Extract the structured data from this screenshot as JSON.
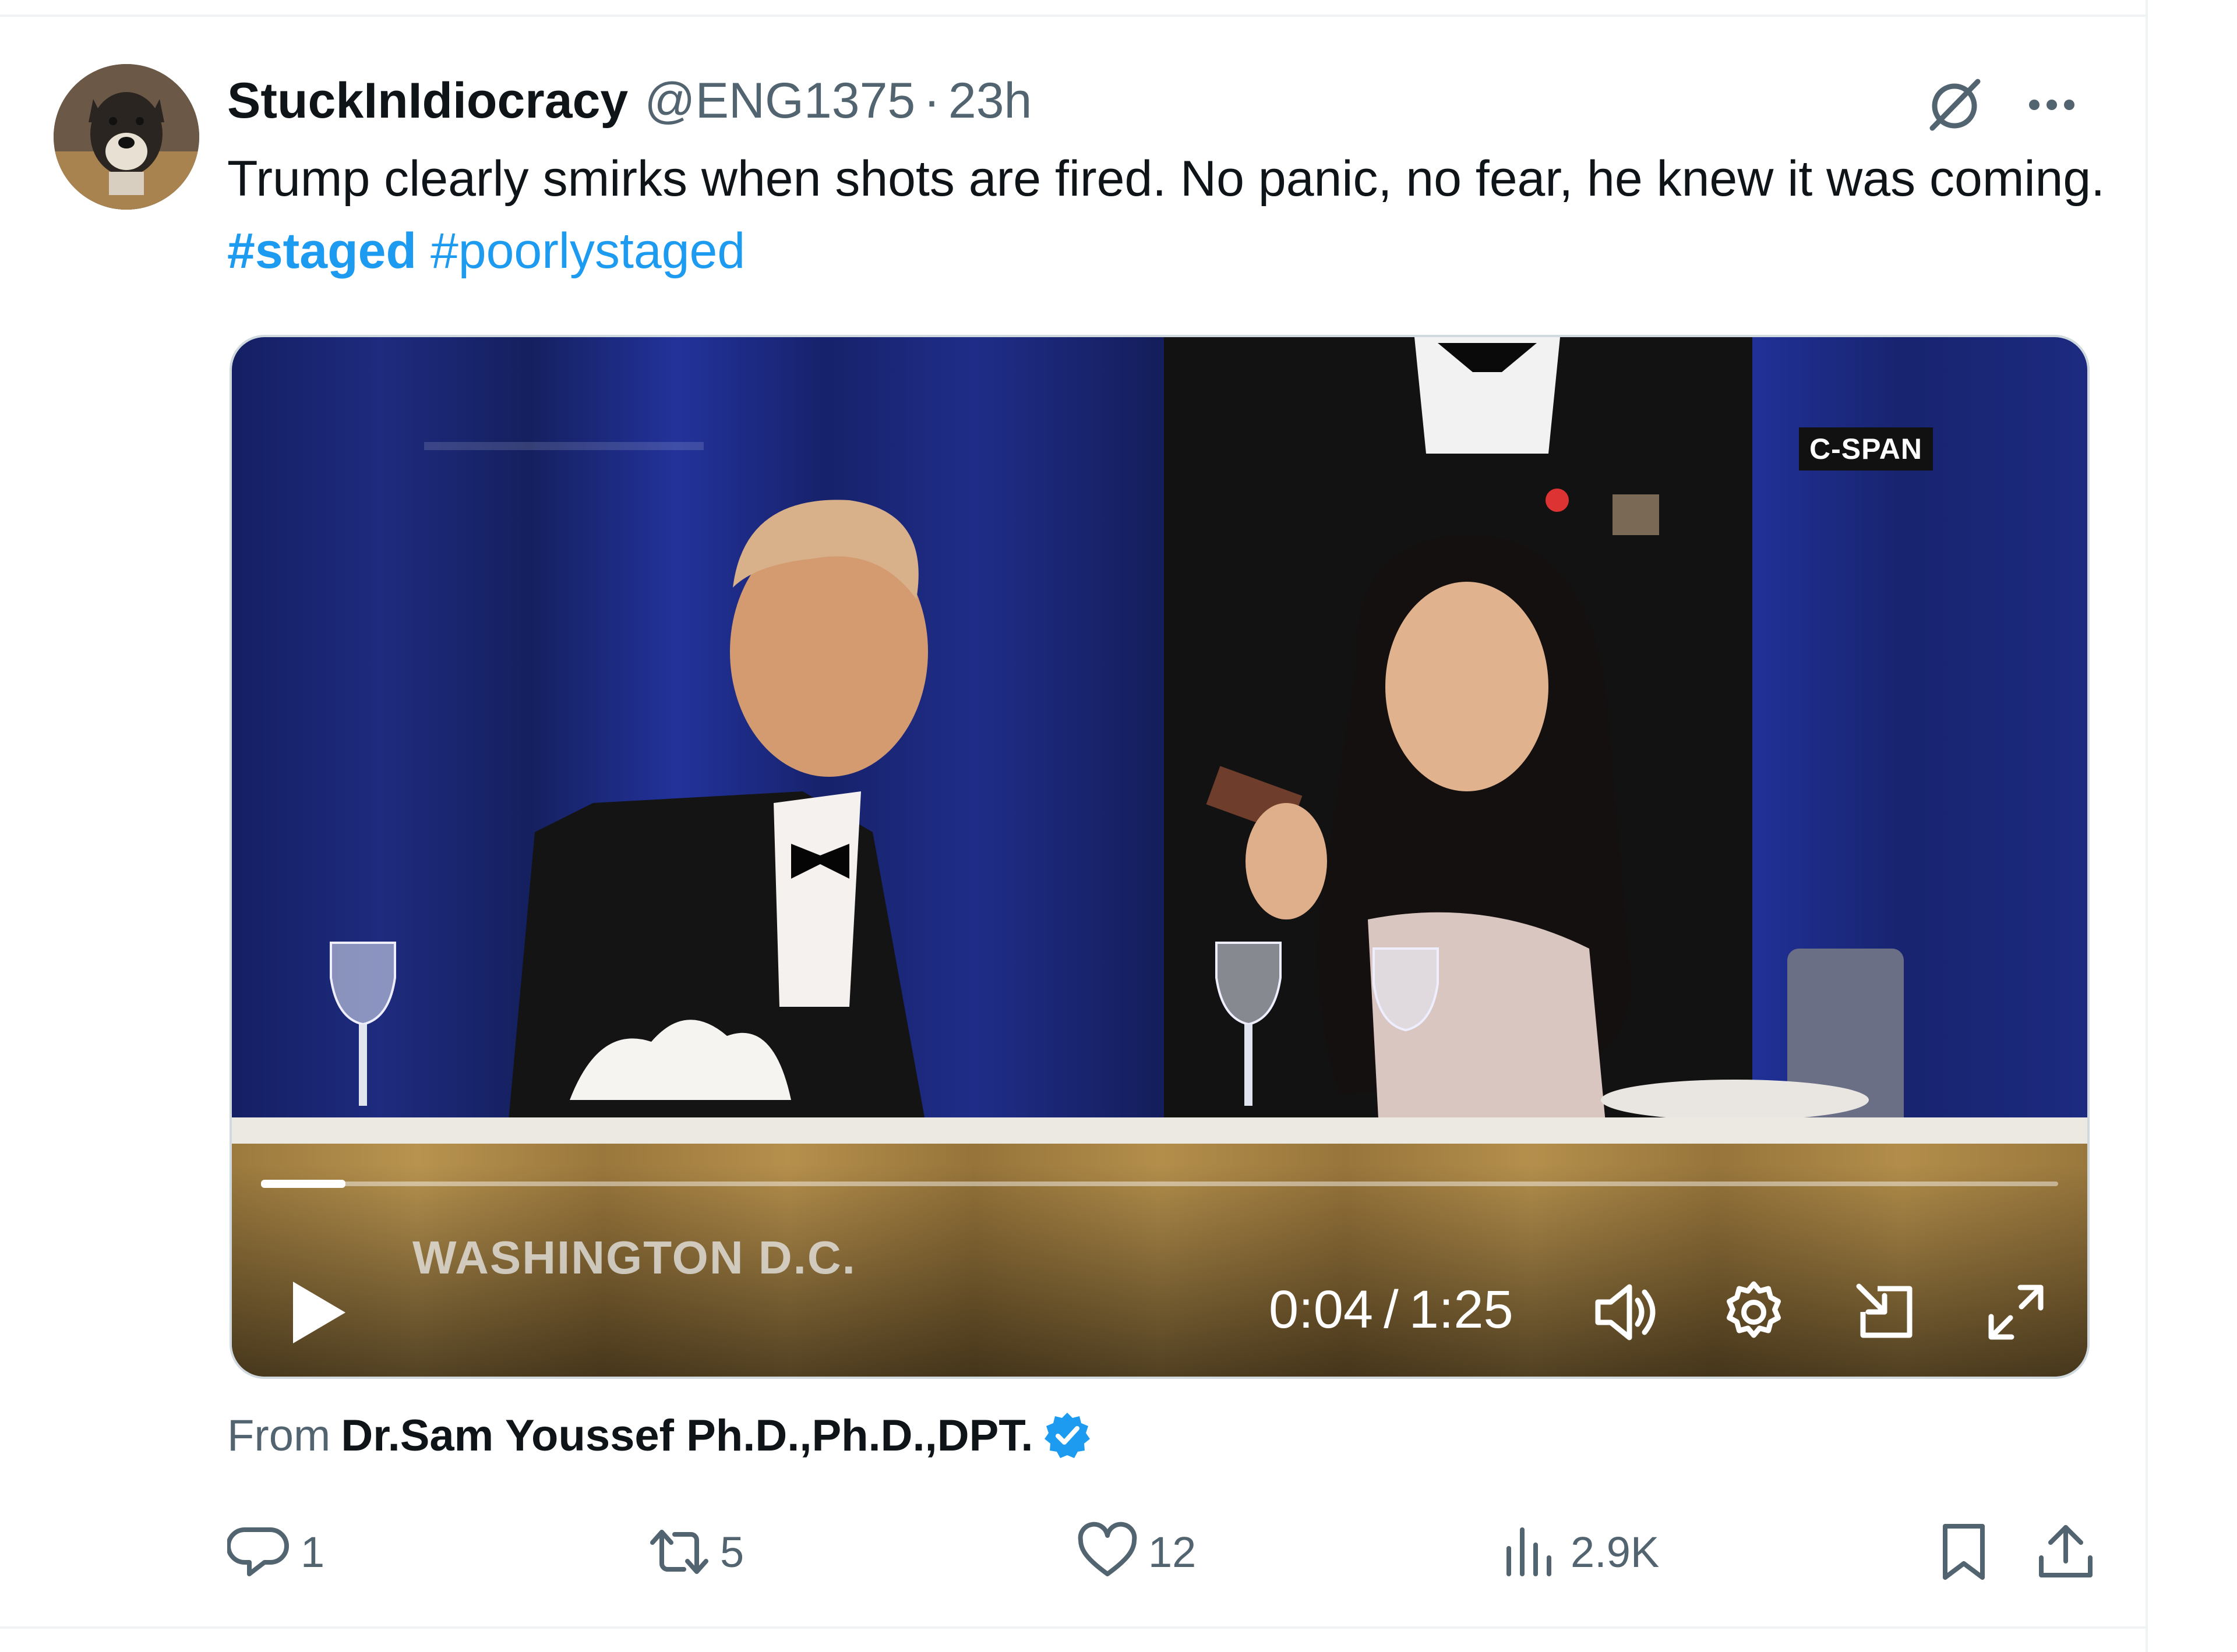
{
  "tweet": {
    "display_name": "StuckInIdiocracy",
    "handle": "@ENG1375",
    "separator": "·",
    "timestamp": "23h",
    "text_main": "Trump clearly smirks when shots are fired. No panic, no fear, he knew it was coming.",
    "hashtags": [
      "#staged",
      "#poorlystaged"
    ]
  },
  "media": {
    "watermark_badge": "C-SPAN",
    "location_caption": "WASHINGTON D.C.",
    "time_current": "0:04",
    "time_separator": "/",
    "time_total": "1:25",
    "progress_fraction": 0.047,
    "icons": {
      "play": "play-icon",
      "volume": "volume-icon",
      "settings": "gear-icon",
      "pip": "picture-in-picture-icon",
      "fullscreen": "fullscreen-icon"
    }
  },
  "attribution": {
    "label": "From",
    "source_name": "Dr.Sam Youssef Ph.D.,Ph.D.,DPT."
  },
  "actions": {
    "replies": "1",
    "reposts": "5",
    "likes": "12",
    "views": "2.9K"
  },
  "colors": {
    "link": "#1d9bf0",
    "muted": "#536471",
    "text": "#0f1419",
    "divider": "#eff3f4"
  }
}
